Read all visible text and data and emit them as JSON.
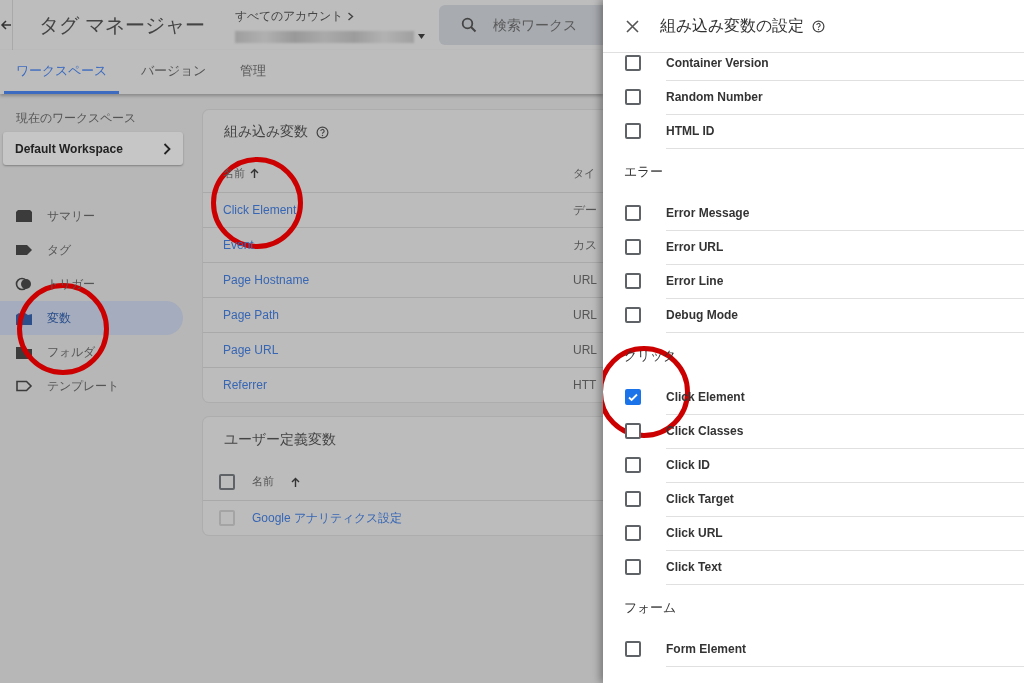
{
  "header": {
    "product_name": "タグ マネージャー",
    "account_path": "すべてのアカウント",
    "search": {
      "placeholder": "検索ワークス"
    }
  },
  "tabs": [
    {
      "label": "ワークスペース",
      "selected": true
    },
    {
      "label": "バージョン",
      "selected": false
    },
    {
      "label": "管理",
      "selected": false
    }
  ],
  "sidebar": {
    "workspace_caption": "現在のワークスペース",
    "workspace_button": "Default Workspace",
    "items": [
      {
        "kind": "summary",
        "label": "サマリー",
        "selected": false,
        "circled": false
      },
      {
        "kind": "tag",
        "label": "タグ",
        "selected": false,
        "circled": false
      },
      {
        "kind": "trigger",
        "label": "トリガー",
        "selected": false,
        "circled": false
      },
      {
        "kind": "variable",
        "label": "変数",
        "selected": true,
        "circled": true
      },
      {
        "kind": "folder",
        "label": "フォルダ",
        "selected": false,
        "circled": false
      },
      {
        "kind": "template",
        "label": "テンプレート",
        "selected": false,
        "circled": false
      }
    ]
  },
  "builtin_variables": {
    "title": "組み込み変数",
    "columns": [
      "名前",
      "タイ"
    ],
    "rows": [
      {
        "name": "Click Element",
        "type": "デー",
        "circled": true
      },
      {
        "name": "Event",
        "type": "カス",
        "circled": false
      },
      {
        "name": "Page Hostname",
        "type": "URL",
        "circled": false
      },
      {
        "name": "Page Path",
        "type": "URL",
        "circled": false
      },
      {
        "name": "Page URL",
        "type": "URL",
        "circled": false
      },
      {
        "name": "Referrer",
        "type": "HTT",
        "circled": false
      }
    ]
  },
  "user_variables": {
    "title": "ユーザー定義変数",
    "all_checked": false,
    "columns": [
      "名前"
    ],
    "rows": [
      {
        "name": "Google アナリティクス設定",
        "checked": false
      }
    ]
  },
  "settings_panel": {
    "title": "組み込み変数の設定",
    "groups": [
      {
        "items": [
          {
            "label": "Container Version",
            "checked": false,
            "circled": false
          },
          {
            "label": "Random Number",
            "checked": false,
            "circled": false
          },
          {
            "label": "HTML ID",
            "checked": false,
            "circled": false
          }
        ]
      },
      {
        "heading": "エラー",
        "items": [
          {
            "label": "Error Message",
            "checked": false,
            "circled": false
          },
          {
            "label": "Error URL",
            "checked": false,
            "circled": false
          },
          {
            "label": "Error Line",
            "checked": false,
            "circled": false
          },
          {
            "label": "Debug Mode",
            "checked": false,
            "circled": false
          }
        ]
      },
      {
        "heading": "クリック",
        "items": [
          {
            "label": "Click Element",
            "checked": true,
            "circled": true
          },
          {
            "label": "Click Classes",
            "checked": false,
            "circled": false
          },
          {
            "label": "Click ID",
            "checked": false,
            "circled": false
          },
          {
            "label": "Click Target",
            "checked": false,
            "circled": false
          },
          {
            "label": "Click URL",
            "checked": false,
            "circled": false
          },
          {
            "label": "Click Text",
            "checked": false,
            "circled": false
          }
        ]
      },
      {
        "heading": "フォーム",
        "items": [
          {
            "label": "Form Element",
            "checked": false,
            "circled": false
          }
        ]
      }
    ]
  }
}
